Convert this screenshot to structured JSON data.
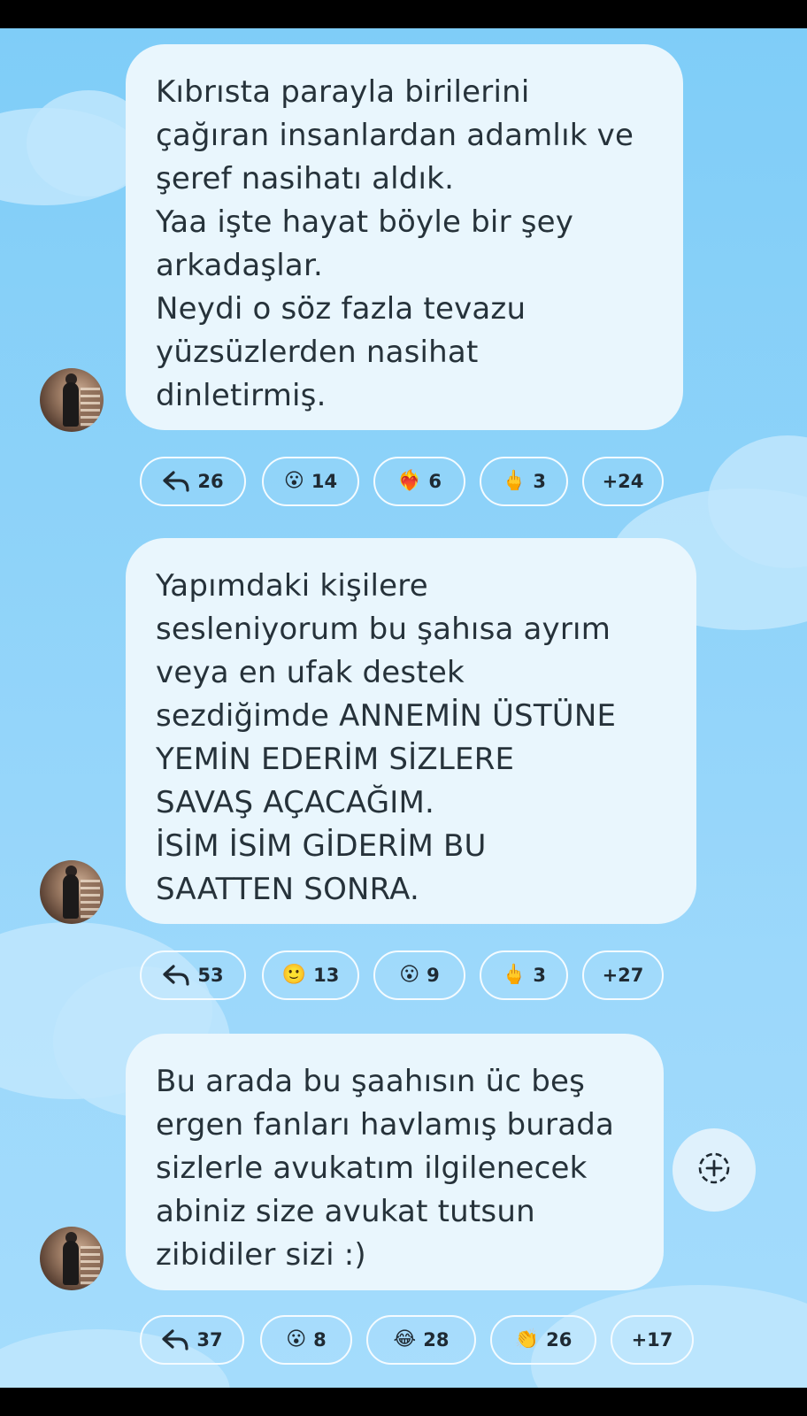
{
  "messages": [
    {
      "text": "Kıbrısta parayla birilerini\nçağıran insanlardan adamlık ve\nşeref nasihatı aldık.\nYaa işte hayat böyle bir şey\narkadaşlar.\nNeydi o söz fazla tevazu\nyüzsüzlerden nasihat\ndinletirmiş.",
      "reactions": [
        {
          "icon": "reply-arrow-icon",
          "glyph": "",
          "count": "26"
        },
        {
          "icon": "surprised-face-icon",
          "glyph": "😮",
          "count": "14"
        },
        {
          "icon": "heart-on-fire-icon",
          "glyph": "❤️‍🔥",
          "count": "6"
        },
        {
          "icon": "middle-finger-icon",
          "glyph": "🖕",
          "count": "3"
        },
        {
          "icon": "",
          "glyph": "",
          "count": "+24"
        }
      ]
    },
    {
      "text": "Yapımdaki kişilere\nsesleniyorum bu şahısa ayrım\nveya en ufak destek\nsezdiğimde ANNEMİN ÜSTÜNE\nYEMİN EDERİM SİZLERE\nSAVAŞ AÇACAĞIM.\nİSİM İSİM GİDERİM BU\nSAATTEN SONRA.",
      "reactions": [
        {
          "icon": "reply-arrow-icon",
          "glyph": "",
          "count": "53"
        },
        {
          "icon": "slightly-smiling-face-icon",
          "glyph": "🙂",
          "count": "13"
        },
        {
          "icon": "surprised-face-icon",
          "glyph": "😮",
          "count": "9"
        },
        {
          "icon": "middle-finger-icon",
          "glyph": "🖕",
          "count": "3"
        },
        {
          "icon": "",
          "glyph": "",
          "count": "+27"
        }
      ]
    },
    {
      "text": "Bu arada bu şaahısın üc beş\nergen fanları havlamış burada\nsizlerle avukatım ilgilenecek\nabiniz size avukat tutsun\nzibidiler sizi :)",
      "reactions": [
        {
          "icon": "reply-arrow-icon",
          "glyph": "",
          "count": "37"
        },
        {
          "icon": "surprised-face-icon",
          "glyph": "😮",
          "count": "8"
        },
        {
          "icon": "tears-of-joy-icon",
          "glyph": "😂",
          "count": "28"
        },
        {
          "icon": "clapping-hands-icon",
          "glyph": "👏",
          "count": "26"
        },
        {
          "icon": "",
          "glyph": "",
          "count": "+17"
        }
      ]
    }
  ],
  "add_reaction_icon": "add-reaction-icon"
}
